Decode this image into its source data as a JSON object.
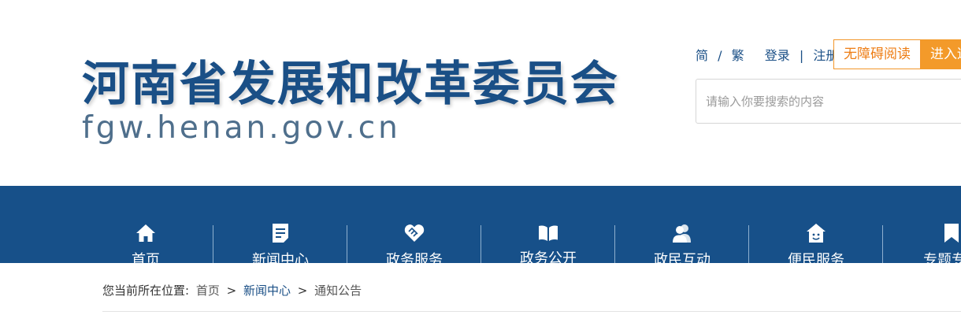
{
  "header": {
    "title": "河南省发展和改革委员会",
    "domain": "fgw.henan.gov.cn"
  },
  "top_links": {
    "simplified": "简",
    "slash": "/",
    "traditional": "繁",
    "login": "登录",
    "bar": "|",
    "register": "注册",
    "accessibility": "无障碍阅读",
    "enter": "进入适"
  },
  "search": {
    "placeholder": "请输入你要搜索的内容"
  },
  "nav": {
    "items": [
      {
        "label": "首页",
        "icon": "home-icon"
      },
      {
        "label": "新闻中心",
        "icon": "news-icon"
      },
      {
        "label": "政务服务",
        "icon": "handshake-icon"
      },
      {
        "label": "政务公开",
        "icon": "book-icon"
      },
      {
        "label": "政民互动",
        "icon": "users-icon"
      },
      {
        "label": "便民服务",
        "icon": "service-house-icon"
      },
      {
        "label": "专题专栏",
        "icon": "bookmark-icon"
      }
    ]
  },
  "breadcrumb": {
    "prefix": "您当前所在位置:",
    "sep": ">",
    "items": [
      "首页",
      "新闻中心",
      "通知公告"
    ]
  },
  "colors": {
    "brand": "#1a4f86",
    "nav_bg": "#175089",
    "accent_orange": "#f39a2a"
  }
}
